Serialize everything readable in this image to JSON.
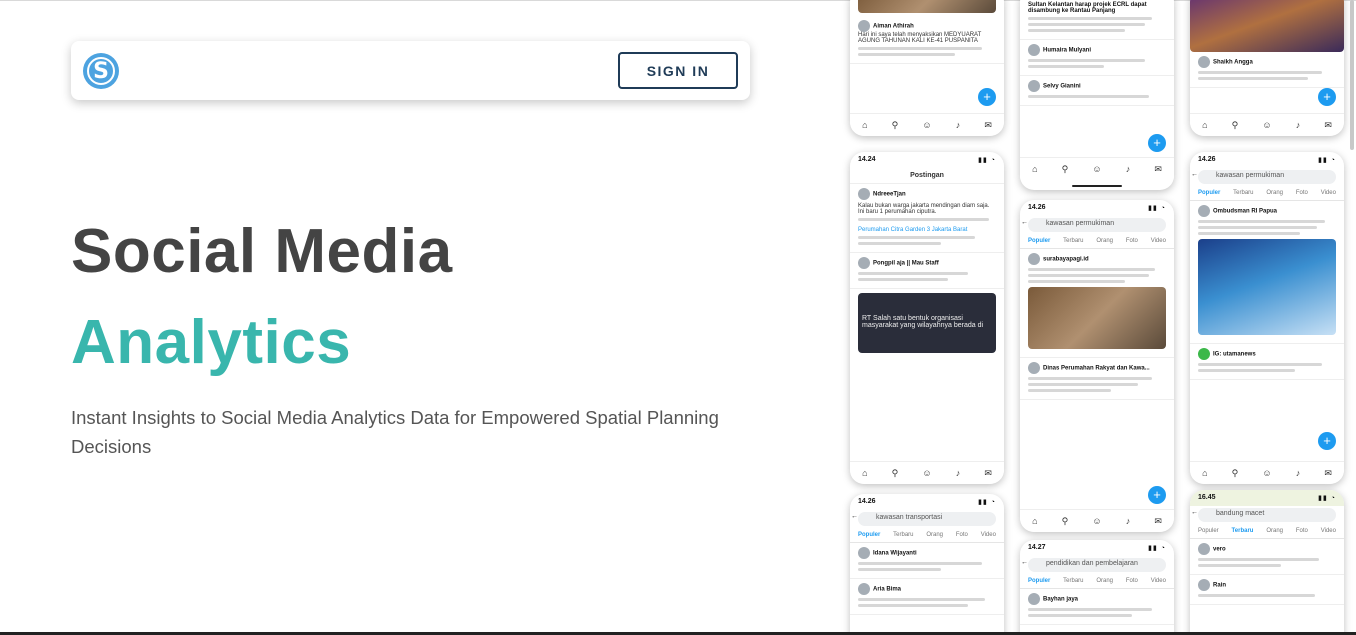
{
  "navbar": {
    "signin_label": "SIGN IN",
    "logo_letter": "S"
  },
  "hero": {
    "line1": "Social Media",
    "line2": "Analytics",
    "tagline": "Instant Insights to Social Media Analytics Data for Empowered Spatial Planning Decisions"
  },
  "colors": {
    "accent": "#39b6ad",
    "heading": "#444444",
    "navy": "#1f3b57",
    "twitter_blue": "#1d9bf0"
  },
  "phones": {
    "p1": {
      "post_name": "Aiman Athirah",
      "post_text": "Hari ini saya telah menyaksikan MEDYUARAT AGUNG TAHUNAN KALI KE-41 PUSPANITA"
    },
    "p2": {
      "time": "14.24",
      "header": "Postingan",
      "post_name": "NdreeeTjan",
      "post_text": "Kalau bukan warga jakarta mendingan diam saja. Ini baru 1 perumahan ciputra.",
      "link_title": "Perumahan Citra Garden 3 Jakarta Barat",
      "reply_name": "Pongpil aja || Mau Staff",
      "dark_text": "RT Salah satu bentuk organisasi masyarakat yang wilayahnya berada di"
    },
    "p3": {
      "time": "14.26",
      "search": "kawasan transportasi",
      "tabs": [
        "Populer",
        "Terbaru",
        "Orang",
        "Foto",
        "Video"
      ],
      "post1_name": "Idana Wijayanti",
      "post2_name": "Aria Bima"
    },
    "p4": {
      "post_name": "Humaira Mulyani",
      "post2_name": "Selvy Gianini",
      "headline": "Sultan Kelantan harap projek ECRL dapat disambung ke Rantau Panjang"
    },
    "p5": {
      "time": "14.26",
      "search": "kawasan permukiman",
      "tabs": [
        "Populer",
        "Terbaru",
        "Orang",
        "Foto",
        "Video"
      ],
      "post_name": "surabayapagi.id",
      "post2_name": "Dinas Perumahan Rakyat dan Kawa..."
    },
    "p6": {
      "time": "14.27",
      "search": "pendidikan dan pembelajaran",
      "tabs": [
        "Populer",
        "Terbaru",
        "Orang",
        "Foto",
        "Video"
      ],
      "post_name": "Bayhan jaya"
    },
    "p7": {
      "post_name": "Shaikh Angga"
    },
    "p8": {
      "time": "14.26",
      "search": "kawasan permukiman",
      "tabs": [
        "Populer",
        "Terbaru",
        "Orang",
        "Foto",
        "Video"
      ],
      "post_name": "Ombudsman RI Papua",
      "post2_name": "IG: utamanews"
    },
    "p9": {
      "time": "16.45",
      "search": "bandung macet",
      "tabs": [
        "Populer",
        "Terbaru",
        "Orang",
        "Foto",
        "Video"
      ],
      "post_name": "vero",
      "post2_name": "Rain"
    }
  }
}
